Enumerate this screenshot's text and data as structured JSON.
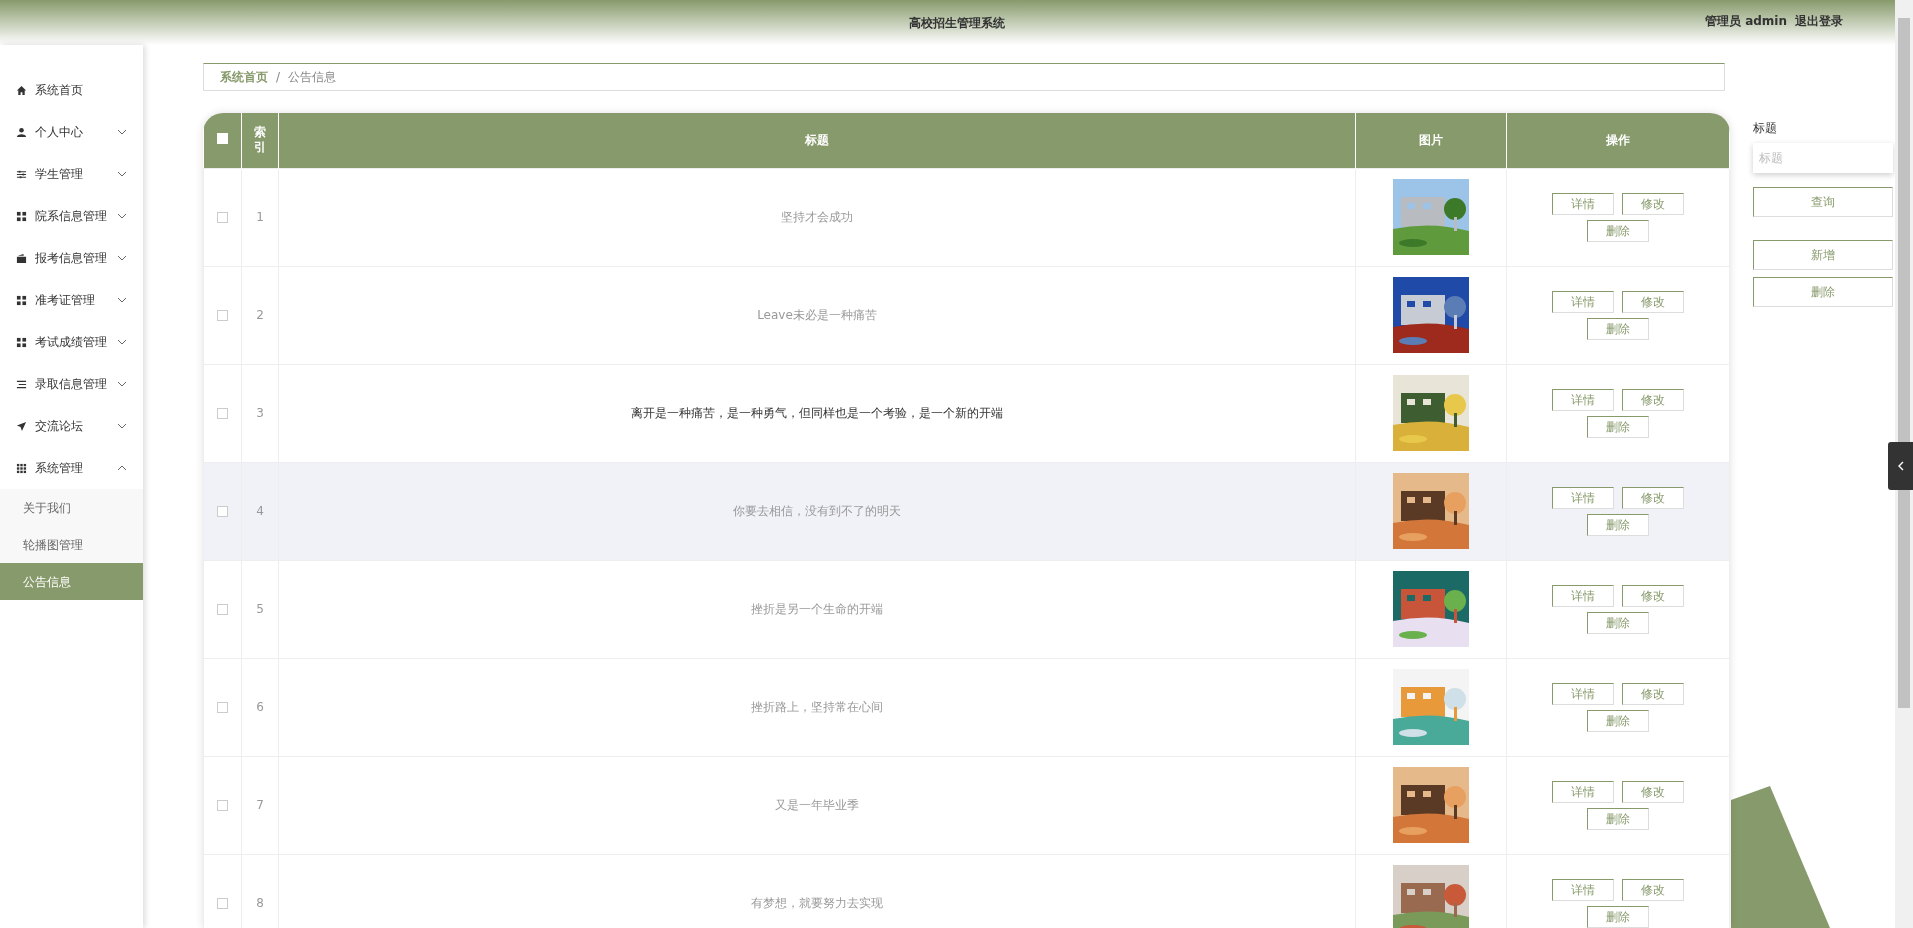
{
  "header": {
    "title": "高校招生管理系统",
    "user": "管理员 admin",
    "logout": "退出登录"
  },
  "sidebar": {
    "items": [
      {
        "label": "系统首页",
        "kind": "link"
      },
      {
        "label": "个人中心",
        "kind": "group",
        "expanded": false
      },
      {
        "label": "学生管理",
        "kind": "group",
        "expanded": false
      },
      {
        "label": "院系信息管理",
        "kind": "group",
        "expanded": false
      },
      {
        "label": "报考信息管理",
        "kind": "group",
        "expanded": false
      },
      {
        "label": "准考证管理",
        "kind": "group",
        "expanded": false
      },
      {
        "label": "考试成绩管理",
        "kind": "group",
        "expanded": false
      },
      {
        "label": "录取信息管理",
        "kind": "group",
        "expanded": false
      },
      {
        "label": "交流论坛",
        "kind": "group",
        "expanded": false
      },
      {
        "label": "系统管理",
        "kind": "group",
        "expanded": true,
        "children": [
          {
            "label": "关于我们",
            "selected": false
          },
          {
            "label": "轮播图管理",
            "selected": false
          },
          {
            "label": "公告信息",
            "selected": true
          }
        ]
      }
    ]
  },
  "breadcrumb": {
    "items": [
      "系统首页",
      "公告信息"
    ],
    "separator": "/"
  },
  "table": {
    "all_checked": false,
    "columns": [
      "索引",
      "标题",
      "图片",
      "操作"
    ],
    "rows": [
      {
        "checked": false,
        "index": "1",
        "title": "坚持才会成功",
        "hovered": false,
        "emphasized": false,
        "actions": [
          "详情",
          "修改",
          "删除"
        ]
      },
      {
        "checked": false,
        "index": "2",
        "title": "Leave未必是一种痛苦",
        "hovered": false,
        "emphasized": false,
        "actions": [
          "详情",
          "修改",
          "删除"
        ]
      },
      {
        "checked": false,
        "index": "3",
        "title": "离开是一种痛苦，是一种勇气，但同样也是一个考验，是一个新的开端",
        "hovered": false,
        "emphasized": true,
        "actions": [
          "详情",
          "修改",
          "删除"
        ]
      },
      {
        "checked": false,
        "index": "4",
        "title": "你要去相信，没有到不了的明天",
        "hovered": true,
        "emphasized": false,
        "actions": [
          "详情",
          "修改",
          "删除"
        ]
      },
      {
        "checked": false,
        "index": "5",
        "title": "挫折是另一个生命的开端",
        "hovered": false,
        "emphasized": false,
        "actions": [
          "详情",
          "修改",
          "删除"
        ]
      },
      {
        "checked": false,
        "index": "6",
        "title": "挫折路上，坚持常在心间",
        "hovered": false,
        "emphasized": false,
        "actions": [
          "详情",
          "修改",
          "删除"
        ]
      },
      {
        "checked": false,
        "index": "7",
        "title": "又是一年毕业季",
        "hovered": false,
        "emphasized": false,
        "actions": [
          "详情",
          "修改",
          "删除"
        ]
      },
      {
        "checked": false,
        "index": "8",
        "title": "有梦想，就要努力去实现",
        "hovered": false,
        "emphasized": false,
        "actions": [
          "详情",
          "修改",
          "删除"
        ]
      }
    ]
  },
  "search": {
    "label": "标题",
    "placeholder": "标题",
    "buttons": [
      "查询",
      "新增",
      "删除"
    ]
  }
}
